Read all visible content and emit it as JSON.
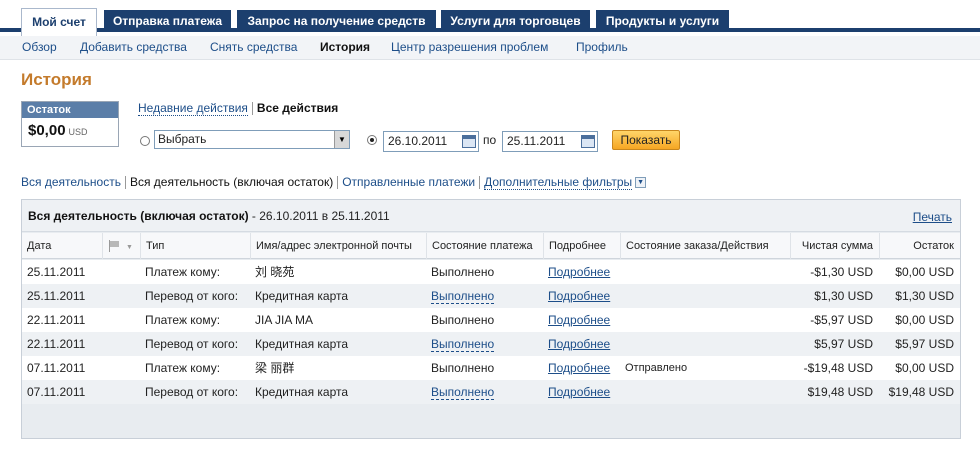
{
  "top_tabs": [
    "Мой счет",
    "Отправка платежа",
    "Запрос на получение средств",
    "Услуги для торговцев",
    "Продукты и услуги"
  ],
  "sub_nav": [
    "Обзор",
    "Добавить средства",
    "Снять средства",
    "История",
    "Центр разрешения проблем",
    "Профиль"
  ],
  "page_title": "История",
  "balance": {
    "label": "Остаток",
    "amount": "$0,00",
    "currency": "USD"
  },
  "filter_tabs": {
    "recent": "Недавние действия",
    "all": "Все действия"
  },
  "filters": {
    "select_value": "Выбрать",
    "date_from": "26.10.2011",
    "date_to_label": "по",
    "date_to": "25.11.2011",
    "show_button": "Показать"
  },
  "activity_links": {
    "all_activity": "Вся деятельность",
    "all_with_balance": "Вся деятельность (включая остаток)",
    "sent_payments": "Отправленные платежи",
    "more_filters": "Дополнительные фильтры"
  },
  "table": {
    "title": "Вся деятельность (включая остаток)",
    "range": " - 26.10.2011 в 25.11.2011",
    "print": "Печать",
    "headers": [
      "Дата",
      "Тип",
      "Имя/адрес электронной почты",
      "Состояние платежа",
      "Подробнее",
      "Состояние заказа/Действия",
      "Чистая сумма",
      "Остаток"
    ],
    "rows": [
      {
        "date": "25.11.2011",
        "type": "Платеж кому:",
        "name": "刘 晓苑",
        "status": "Выполнено",
        "status_link": false,
        "details": "Подробнее",
        "order": "",
        "net": "-$1,30 USD",
        "balance": "$0,00 USD"
      },
      {
        "date": "25.11.2011",
        "type": "Перевод от кого:",
        "name": "Кредитная карта",
        "status": "Выполнено",
        "status_link": true,
        "details": "Подробнее",
        "order": "",
        "net": "$1,30 USD",
        "balance": "$1,30 USD"
      },
      {
        "date": "22.11.2011",
        "type": "Платеж кому:",
        "name": "JIA JIA MA",
        "status": "Выполнено",
        "status_link": false,
        "details": "Подробнее",
        "order": "",
        "net": "-$5,97 USD",
        "balance": "$0,00 USD"
      },
      {
        "date": "22.11.2011",
        "type": "Перевод от кого:",
        "name": "Кредитная карта",
        "status": "Выполнено",
        "status_link": true,
        "details": "Подробнее",
        "order": "",
        "net": "$5,97 USD",
        "balance": "$5,97 USD"
      },
      {
        "date": "07.11.2011",
        "type": "Платеж кому:",
        "name": "梁 丽群",
        "status": "Выполнено",
        "status_link": false,
        "details": "Подробнее",
        "order": "Отправлено",
        "net": "-$19,48 USD",
        "balance": "$0,00 USD"
      },
      {
        "date": "07.11.2011",
        "type": "Перевод от кого:",
        "name": "Кредитная карта",
        "status": "Выполнено",
        "status_link": true,
        "details": "Подробнее",
        "order": "",
        "net": "$19,48 USD",
        "balance": "$19,48 USD"
      }
    ]
  },
  "colors": {
    "nav_blue": "#1c3f6e",
    "link_blue": "#1d4e89",
    "title_orange": "#c47b2c",
    "button_orange": "#f6a623"
  }
}
